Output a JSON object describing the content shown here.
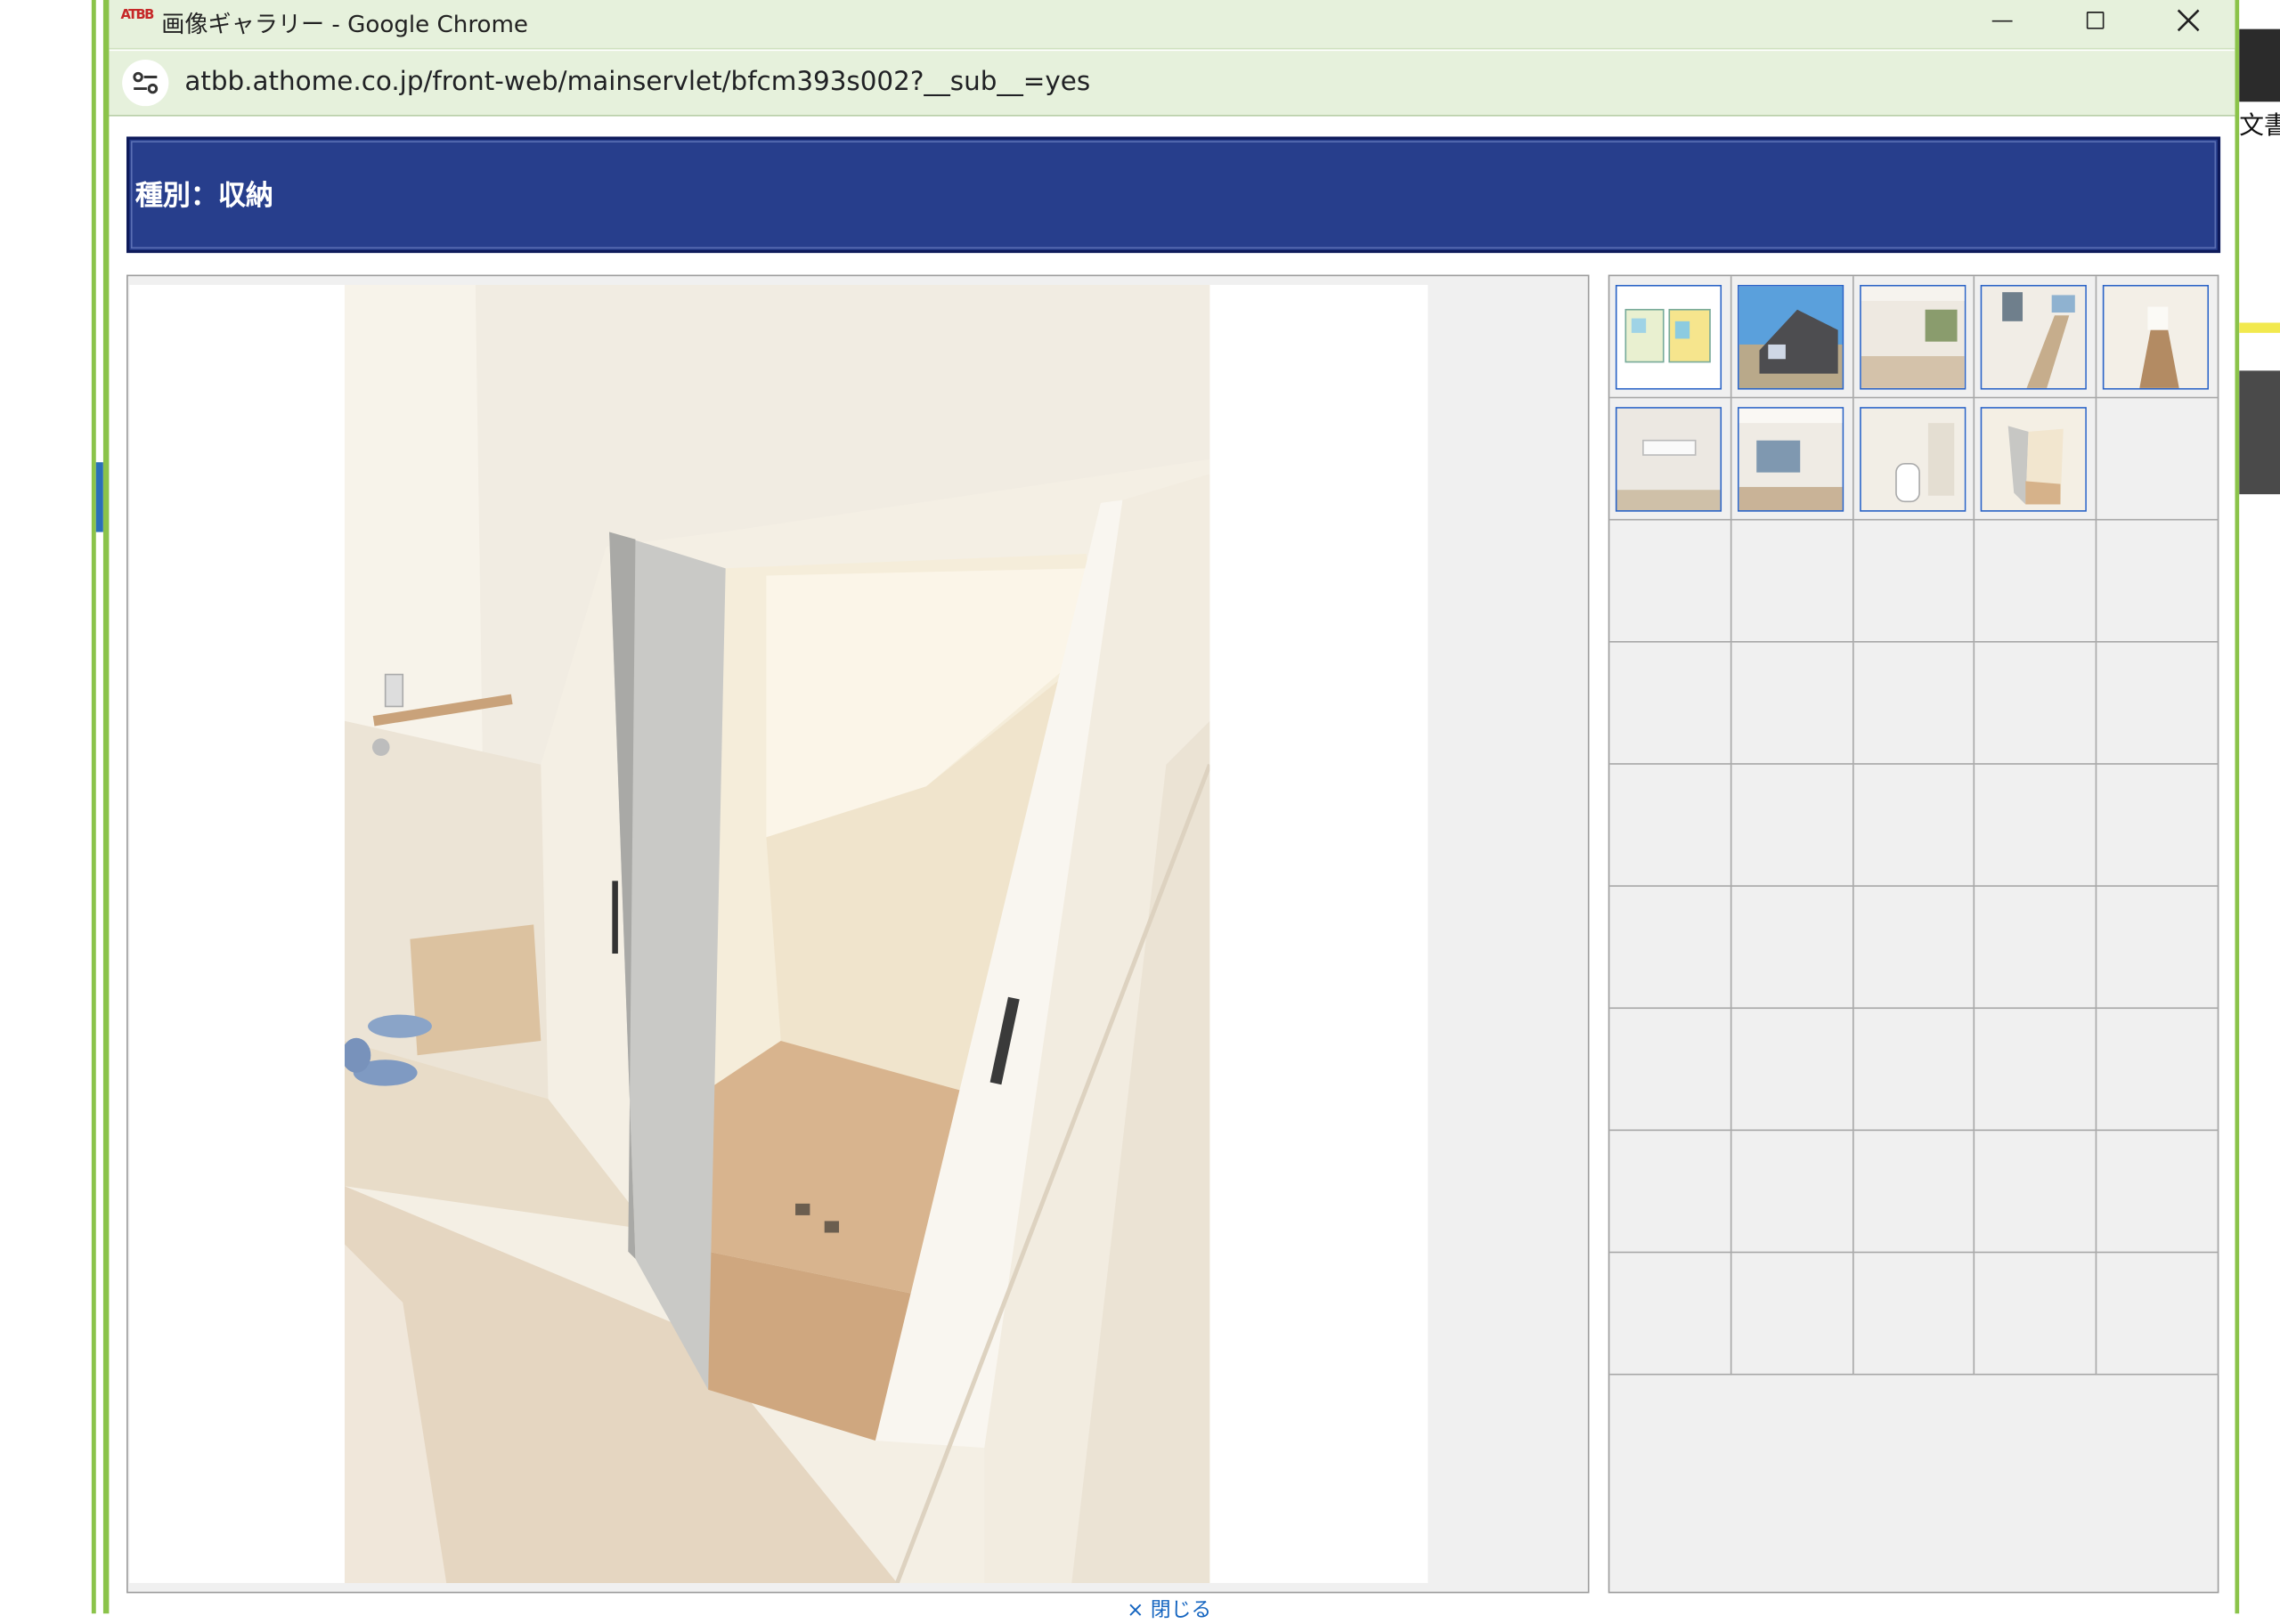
{
  "window": {
    "app_icon_text": "ATBB",
    "title": "画像ギャラリー - Google Chrome"
  },
  "address_bar": {
    "url": "atbb.athome.co.jp/front-web/mainservlet/bfcm393s002?__sub__=yes"
  },
  "header": {
    "title": "種別：収納"
  },
  "thumbnails": [
    {
      "name": "floor-plan",
      "selected": false
    },
    {
      "name": "exterior",
      "selected": false
    },
    {
      "name": "living-room",
      "selected": false
    },
    {
      "name": "stairwell",
      "selected": false
    },
    {
      "name": "hallway",
      "selected": false
    },
    {
      "name": "bedroom-aircon",
      "selected": false
    },
    {
      "name": "room-window",
      "selected": false
    },
    {
      "name": "toilet",
      "selected": false
    },
    {
      "name": "storage-closet",
      "selected": true
    }
  ],
  "grid": {
    "columns": 5,
    "rows": 10
  },
  "footer": {
    "close_label": "× 閉じる"
  },
  "right_edge": {
    "text": "文書"
  },
  "colors": {
    "window_frame": "#8bc34a",
    "header_banner": "#273e8c",
    "thumb_border": "#2a63c6",
    "link": "#1565c0"
  }
}
